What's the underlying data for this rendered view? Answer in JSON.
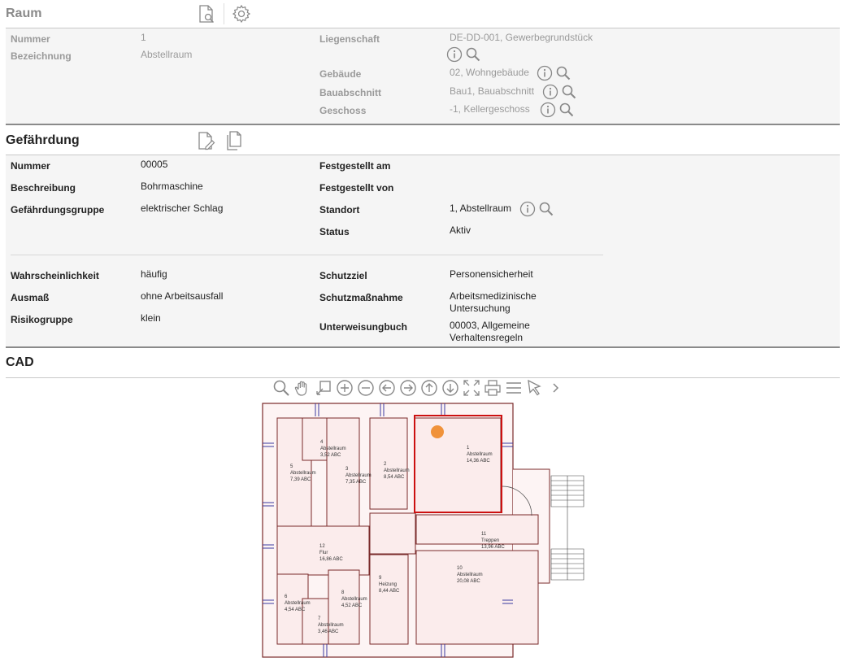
{
  "raum": {
    "title": "Raum",
    "fields_left": [
      {
        "label": "Nummer",
        "value": "1"
      },
      {
        "label": "Bezeichnung",
        "value": "Abstellraum"
      }
    ],
    "fields_right": [
      {
        "label": "Liegenschaft",
        "value": "DE-DD-001, Gewerbegrundstück"
      },
      {
        "label": "Gebäude",
        "value": "02, Wohngebäude"
      },
      {
        "label": "Bauabschnitt",
        "value": "Bau1, Bauabschnitt"
      },
      {
        "label": "Geschoss",
        "value": "-1, Kellergeschoss"
      }
    ]
  },
  "gefaehrdung": {
    "title": "Gefährdung",
    "fields_left": [
      {
        "label": "Nummer",
        "value": "00005"
      },
      {
        "label": "Beschreibung",
        "value": "Bohrmaschine"
      },
      {
        "label": "Gefährdungsgruppe",
        "value": "elektrischer Schlag"
      }
    ],
    "fields_right": [
      {
        "label": "Festgestellt am",
        "value": ""
      },
      {
        "label": "Festgestellt von",
        "value": ""
      },
      {
        "label": "Standort",
        "value": "1, Abstellraum"
      },
      {
        "label": "Status",
        "value": "Aktiv"
      }
    ],
    "fields_left2": [
      {
        "label": "Wahrscheinlichkeit",
        "value": "häufig"
      },
      {
        "label": "Ausmaß",
        "value": "ohne Arbeitsausfall"
      },
      {
        "label": "Risikogruppe",
        "value": "klein"
      }
    ],
    "fields_right2": [
      {
        "label": "Schutzziel",
        "value": "Personensicherheit"
      },
      {
        "label": "Schutzmaßnahme",
        "value": "Arbeitsmedizinische",
        "value2": "Untersuchung"
      },
      {
        "label": "Unterweisungbuch",
        "value": "00003, Allgemeine",
        "value2": "Verhaltensregeln"
      }
    ]
  },
  "cad": {
    "title": "CAD",
    "toolbar": [
      "zoom-icon",
      "pan-hand-icon",
      "zoom-window-icon",
      "zoom-in-icon",
      "zoom-out-icon",
      "arrow-left-icon",
      "arrow-right-icon",
      "arrow-up-icon",
      "arrow-down-icon",
      "fit-extent-icon",
      "print-icon",
      "menu-icon",
      "select-pointer-icon",
      "chevron-right-icon"
    ],
    "rooms": [
      {
        "no": "1",
        "name": "Abstellraum",
        "area": "14,36 ABC"
      },
      {
        "no": "2",
        "name": "Abstellraum",
        "area": "8,54 ABC"
      },
      {
        "no": "3",
        "name": "Abstellraum",
        "area": "7,35 ABC"
      },
      {
        "no": "4",
        "name": "Abstellraum",
        "area": "3,52 ABC"
      },
      {
        "no": "5",
        "name": "Abstellraum",
        "area": "7,39 ABC"
      },
      {
        "no": "6",
        "name": "Abstellraum",
        "area": "4,54 ABC"
      },
      {
        "no": "7",
        "name": "Abstellraum",
        "area": "3,46 ABC"
      },
      {
        "no": "8",
        "name": "Abstellraum",
        "area": "4,52 ABC"
      },
      {
        "no": "9",
        "name": "Heizung",
        "area": "8,44 ABC"
      },
      {
        "no": "10",
        "name": "Abstellraum",
        "area": "20,08 ABC"
      },
      {
        "no": "11",
        "name": "Treppen",
        "area": "13,96 ABC"
      },
      {
        "no": "12",
        "name": "Flur",
        "area": "16,86 ABC"
      }
    ],
    "colors": {
      "highlight": "#cc1111",
      "marker": "#f0923a",
      "room_fill": "#fbecec",
      "wall": "#7a2a2a",
      "window": "#3a3aa0"
    }
  }
}
